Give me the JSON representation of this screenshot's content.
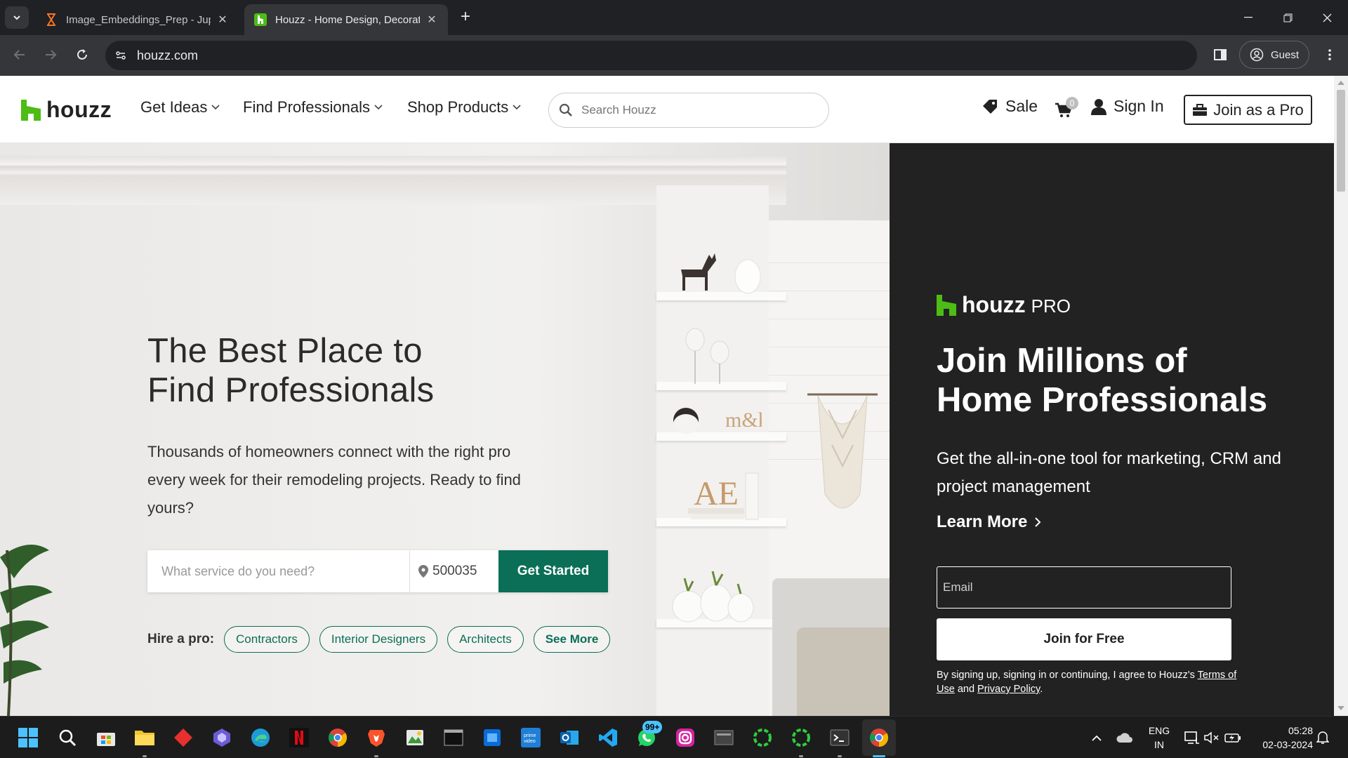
{
  "browser": {
    "tabs": [
      {
        "title": "Image_Embeddings_Prep - Jupy",
        "active": false
      },
      {
        "title": "Houzz - Home Design, Decorati",
        "active": true
      }
    ],
    "url": "houzz.com",
    "profile": "Guest"
  },
  "header": {
    "logo": "houzz",
    "nav": [
      "Get Ideas",
      "Find Professionals",
      "Shop Products"
    ],
    "search_placeholder": "Search Houzz",
    "sale": "Sale",
    "cart_count": "0",
    "sign_in": "Sign In",
    "join_pro": "Join as a Pro"
  },
  "hero": {
    "title_line1": "The Best Place to",
    "title_line2": "Find Professionals",
    "text": "Thousands of homeowners connect with the right pro every week for their remodeling projects. Ready to find yours?",
    "service_placeholder": "What service do you need?",
    "zip": "500035",
    "cta": "Get Started",
    "hire_label": "Hire a pro:",
    "chips": [
      "Contractors",
      "Interior Designers",
      "Architects",
      "See More"
    ],
    "accent": "#0b6e56"
  },
  "pro_panel": {
    "logo": "houzz",
    "logo_suffix": "PRO",
    "title_line1": "Join Millions of",
    "title_line2": "Home Professionals",
    "text": "Get the all-in-one tool for marketing, CRM and project management",
    "learn_more": "Learn More",
    "email_placeholder": "Email",
    "join_free": "Join for Free",
    "legal_prefix": "By signing up, signing in or continuing, I agree to Houzz's ",
    "terms": "Terms of Use",
    "and": " and ",
    "privacy": "Privacy Policy",
    "legal_suffix": ".",
    "brand_green": "#4dbc15"
  },
  "taskbar": {
    "whatsapp_badge": "99+",
    "language_line1": "ENG",
    "language_line2": "IN",
    "time": "05:28",
    "date": "02-03-2024"
  }
}
